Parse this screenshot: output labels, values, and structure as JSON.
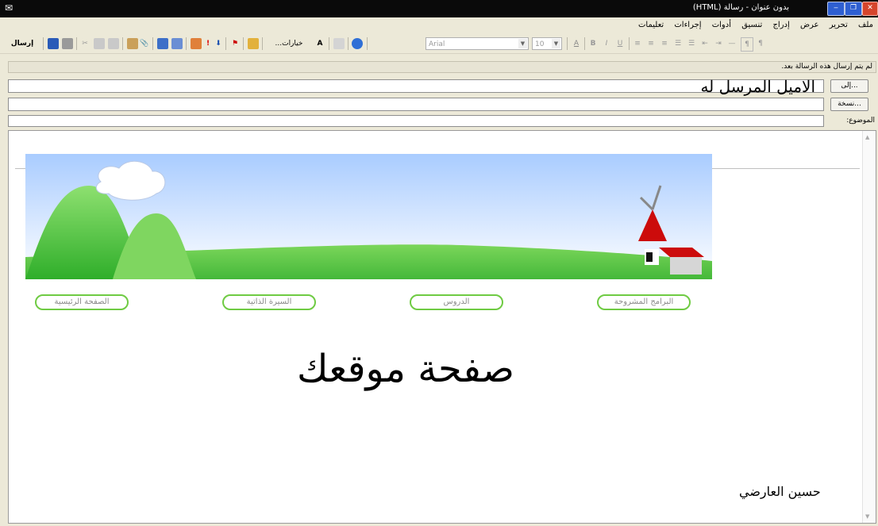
{
  "window": {
    "title": "بدون عنوان - رسالة (HTML)",
    "buttons": [
      "‒",
      "❐",
      "✕"
    ]
  },
  "menu": [
    "ملف",
    "تحرير",
    "عرض",
    "إدراج",
    "تنسيق",
    "أدوات",
    "إجراءات",
    "تعليمات"
  ],
  "toolbar": {
    "send_label": "إرسال",
    "options_label": "خيارات...",
    "font_name": "Arial",
    "font_size": "10"
  },
  "status_text": "لم يتم إرسال هذه الرسالة بعد.",
  "header": {
    "to_button": "إلى...",
    "cc_button": "نسخة...",
    "subject_label": "الموضوع:",
    "to_value": "الاميل المرسل له",
    "cc_value": "",
    "subject_value": ""
  },
  "message": {
    "nav_buttons": [
      "البرامج المشروحة",
      "الدروس",
      "السيرة الذاتية",
      "الصفحة الرئيسية"
    ],
    "headline": "صفحة موقعك",
    "signature": "حسين العارضي"
  },
  "colors": {
    "titlebar": "#0a0a0a",
    "nav_border": "#6fcb43",
    "sky_top": "#9ec7ff",
    "grass": "#5fcf4a"
  }
}
